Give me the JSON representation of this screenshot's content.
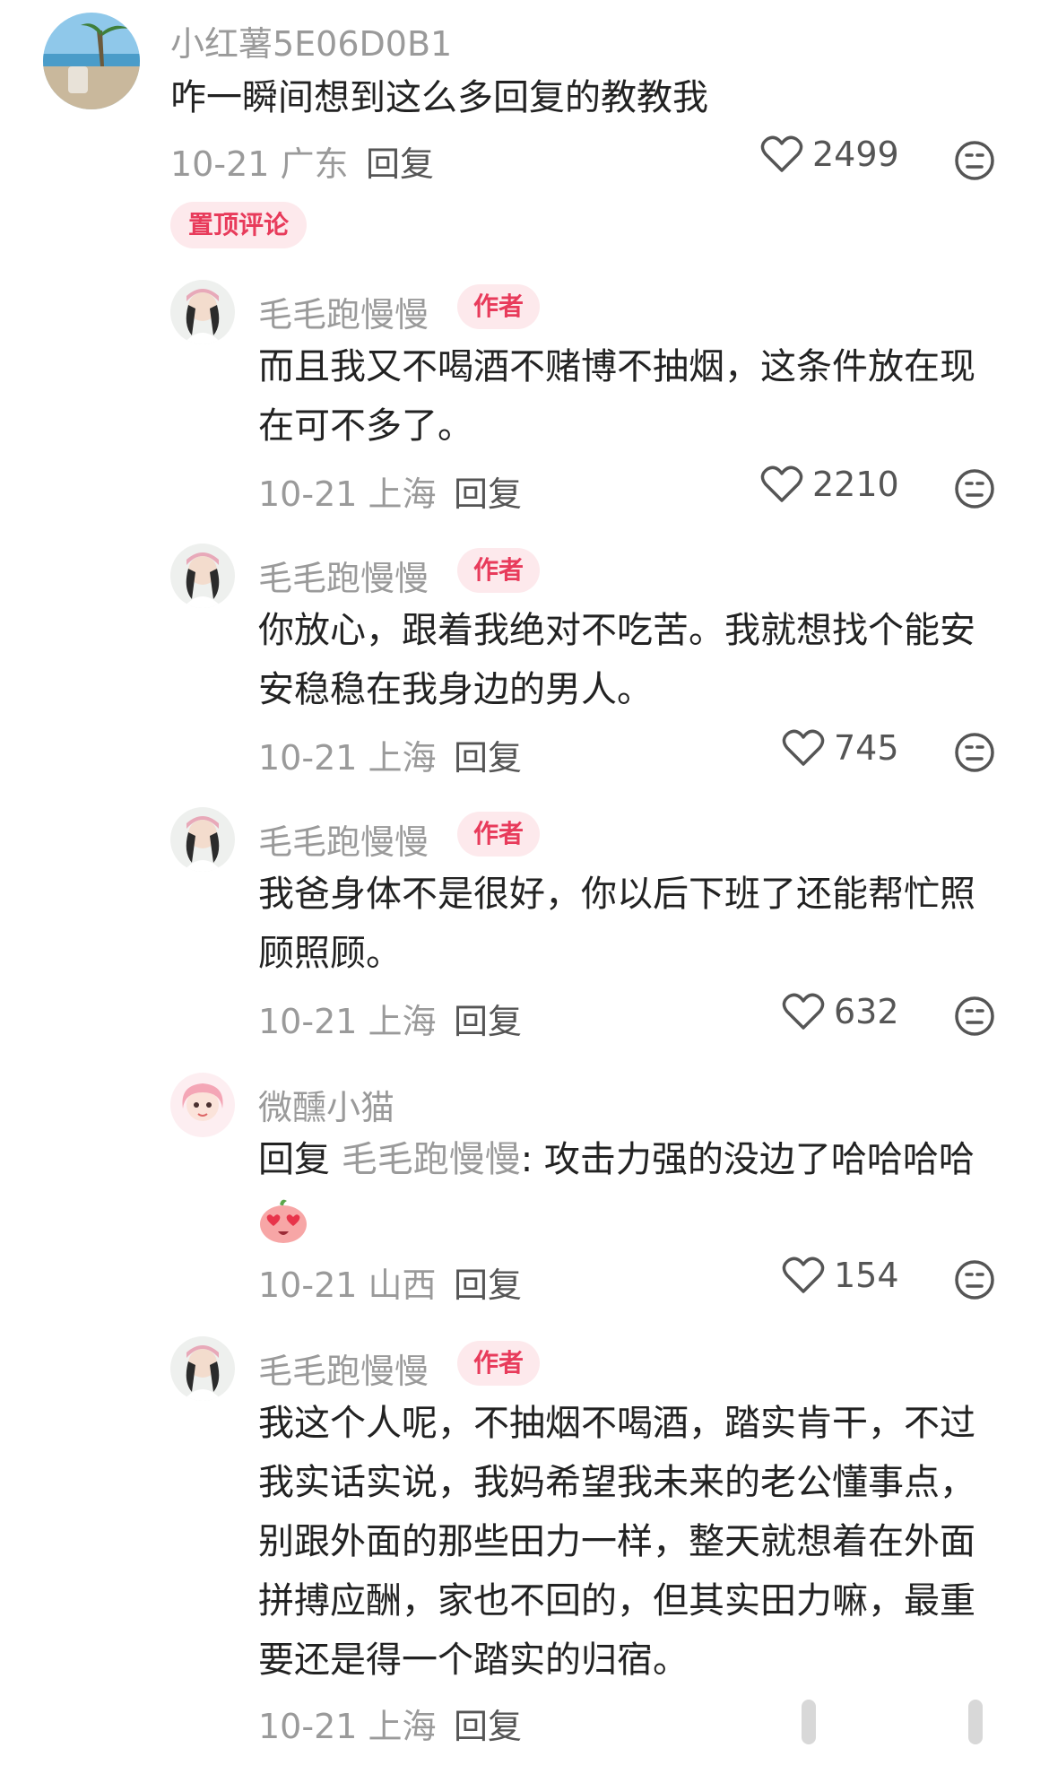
{
  "main_comment": {
    "username": "小红薯5E06D0B1",
    "text": "咋一瞬间想到这么多回复的教教我",
    "date": "10-21",
    "location": "广东",
    "reply_label": "回复",
    "likes": "2499",
    "pinned_label": "置顶评论"
  },
  "replies": [
    {
      "username": "毛毛跑慢慢",
      "badge": "作者",
      "line1": "而且我又不喝酒不赌博不抽烟，这条件放在现",
      "line2": "在可不多了。",
      "date": "10-21",
      "location": "上海",
      "reply_label": "回复",
      "likes": "2210"
    },
    {
      "username": "毛毛跑慢慢",
      "badge": "作者",
      "line1": "你放心，跟着我绝对不吃苦。我就想找个能安",
      "line2": "安稳稳在我身边的男人。",
      "date": "10-21",
      "location": "上海",
      "reply_label": "回复",
      "likes": "745"
    },
    {
      "username": "毛毛跑慢慢",
      "badge": "作者",
      "line1": "我爸身体不是很好，你以后下班了还能帮忙照",
      "line2": "顾照顾。",
      "date": "10-21",
      "location": "上海",
      "reply_label": "回复",
      "likes": "632"
    },
    {
      "username": "微醺小猫",
      "reply_prefix": "回复",
      "reply_to": "毛毛跑慢慢",
      "line1": ": 攻击力强的没边了哈哈哈哈",
      "emoji": "heart-eyes-emoji",
      "date": "10-21",
      "location": "山西",
      "reply_label": "回复",
      "likes": "154"
    },
    {
      "username": "毛毛跑慢慢",
      "badge": "作者",
      "line1": "我这个人呢，不抽烟不喝酒，踏实肯干，不过",
      "line2": "我实话实说，我妈希望我未来的老公懂事点，",
      "line3": "别跟外面的那些田力一样，整天就想着在外面",
      "line4": "拼搏应酬，家也不回的，但其实田力嘛，最重",
      "line5": "要还是得一个踏实的归宿。",
      "date": "10-21",
      "location": "上海",
      "reply_label": "回复"
    }
  ],
  "colors": {
    "accent": "#e83b5b",
    "badge_bg": "#fde9ec",
    "meta": "#9a9a9a"
  },
  "icons": [
    "heart-icon",
    "more-options-icon",
    "avatar"
  ]
}
